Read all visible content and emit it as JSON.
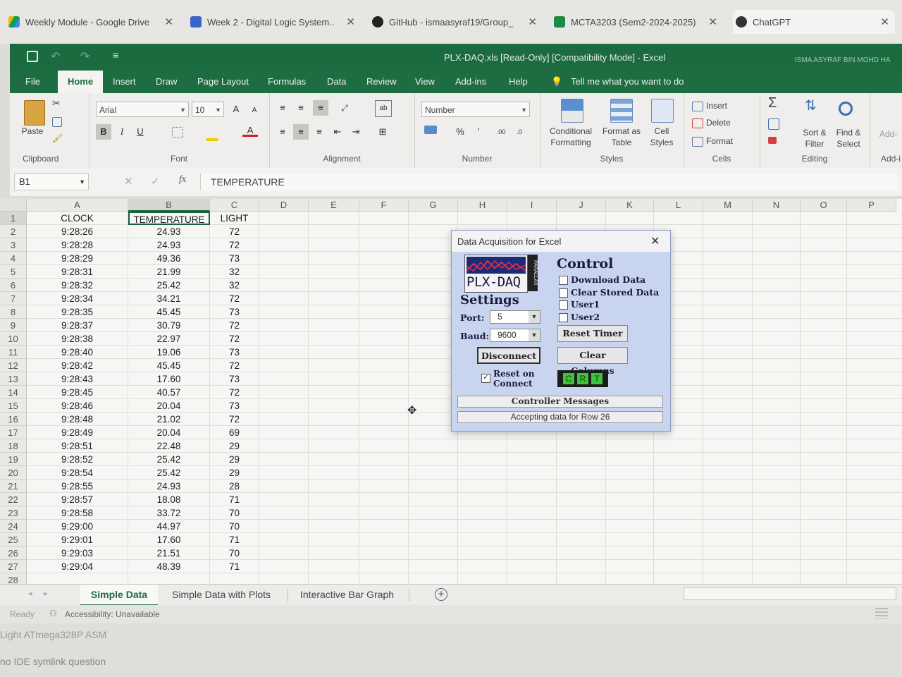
{
  "browser_tabs": [
    {
      "title": "Weekly Module - Google Drive",
      "close": "✕",
      "color": "#3b82c4"
    },
    {
      "title": "Week 2 - Digital Logic System...",
      "close": "✕",
      "color": "#3a64c8"
    },
    {
      "title": "GitHub - ismaasyraf19/Group_",
      "close": "✕",
      "color": "#222222"
    },
    {
      "title": "MCTA3203 (Sem2-2024-2025)...",
      "close": "✕",
      "color": "#1a8a47"
    },
    {
      "title": "ChatGPT",
      "close": "✕",
      "color": "#333333"
    }
  ],
  "excel": {
    "title": "PLX-DAQ.xls  [Read-Only]  [Compatibility Mode]  -  Excel",
    "user": "ISMA ASYRAF BIN MOHD HA",
    "ribbon_tabs": [
      "File",
      "Home",
      "Insert",
      "Draw",
      "Page Layout",
      "Formulas",
      "Data",
      "Review",
      "View",
      "Add-ins",
      "Help"
    ],
    "tell_me": "Tell me what you want to do",
    "clipboard": {
      "paste": "Paste",
      "label": "Clipboard"
    },
    "font": {
      "name": "Arial",
      "size": "10",
      "bold": "B",
      "italic": "I",
      "underline": "U",
      "grow": "A",
      "shrink": "A",
      "label": "Font"
    },
    "alignment": {
      "label": "Alignment"
    },
    "number": {
      "format": "Number",
      "percent": "%",
      "comma": "’",
      "inc": ".00",
      "dec": ".0",
      "label": "Number"
    },
    "styles": {
      "cond1": "Conditional",
      "cond2": "Formatting",
      "fmt1": "Format as",
      "fmt2": "Table",
      "cell1": "Cell",
      "cell2": "Styles",
      "label": "Styles"
    },
    "cells": {
      "insert": "Insert",
      "delete": "Delete",
      "format": "Format",
      "label": "Cells"
    },
    "editing": {
      "sort1": "Sort &",
      "sort2": "Filter",
      "find1": "Find &",
      "find2": "Select",
      "label": "Editing"
    },
    "addins": {
      "label": "Add-i",
      "btn": "Add-"
    },
    "name_box": "B1",
    "formula": "TEMPERATURE",
    "fx": "fx",
    "columns": [
      "A",
      "B",
      "C",
      "D",
      "E",
      "F",
      "G",
      "H",
      "I",
      "J",
      "K",
      "L",
      "M",
      "N",
      "O",
      "P"
    ],
    "rows": [
      [
        "CLOCK",
        "TEMPERATURE",
        "LIGHT"
      ],
      [
        "9:28:26",
        "24.93",
        "72"
      ],
      [
        "9:28:28",
        "24.93",
        "72"
      ],
      [
        "9:28:29",
        "49.36",
        "73"
      ],
      [
        "9:28:31",
        "21.99",
        "32"
      ],
      [
        "9:28:32",
        "25.42",
        "32"
      ],
      [
        "9:28:34",
        "34.21",
        "72"
      ],
      [
        "9:28:35",
        "45.45",
        "73"
      ],
      [
        "9:28:37",
        "30.79",
        "72"
      ],
      [
        "9:28:38",
        "22.97",
        "72"
      ],
      [
        "9:28:40",
        "19.06",
        "73"
      ],
      [
        "9:28:42",
        "45.45",
        "72"
      ],
      [
        "9:28:43",
        "17.60",
        "73"
      ],
      [
        "9:28:45",
        "40.57",
        "72"
      ],
      [
        "9:28:46",
        "20.04",
        "73"
      ],
      [
        "9:28:48",
        "21.02",
        "72"
      ],
      [
        "9:28:49",
        "20.04",
        "69"
      ],
      [
        "9:28:51",
        "22.48",
        "29"
      ],
      [
        "9:28:52",
        "25.42",
        "29"
      ],
      [
        "9:28:54",
        "25.42",
        "29"
      ],
      [
        "9:28:55",
        "24.93",
        "28"
      ],
      [
        "9:28:57",
        "18.08",
        "71"
      ],
      [
        "9:28:58",
        "33.72",
        "70"
      ],
      [
        "9:29:00",
        "44.97",
        "70"
      ],
      [
        "9:29:01",
        "17.60",
        "71"
      ],
      [
        "9:29:03",
        "21.51",
        "70"
      ],
      [
        "9:29:04",
        "48.39",
        "71"
      ],
      [
        "",
        "",
        ""
      ]
    ],
    "sheet_tabs": [
      "Simple Data",
      "Simple Data with Plots",
      "Interactive Bar Graph"
    ],
    "add_sheet": "+",
    "status": "Ready",
    "accessibility": "Accessibility: Unavailable"
  },
  "below_text": [
    "Light ATmega328P ASM",
    "no IDE symlink question"
  ],
  "dialog": {
    "title": "Data Acquisition for Excel",
    "close": "✕",
    "logo": "PLX-DAQ",
    "brand": "PARALLAX",
    "control": "Control",
    "checkboxes": [
      "Download Data",
      "Clear Stored Data",
      "User1",
      "User2"
    ],
    "settings": "Settings",
    "port_label": "Port:",
    "port": "5",
    "baud_label": "Baud:",
    "baud": "9600",
    "reset_timer": "Reset Timer",
    "disconnect": "Disconnect",
    "clear_columns": "Clear Columns",
    "reset1": "Reset on",
    "reset2": "Connect",
    "crt": [
      "C",
      "R",
      "T"
    ],
    "messages_header": "Controller Messages",
    "message": "Accepting data for Row 26"
  }
}
